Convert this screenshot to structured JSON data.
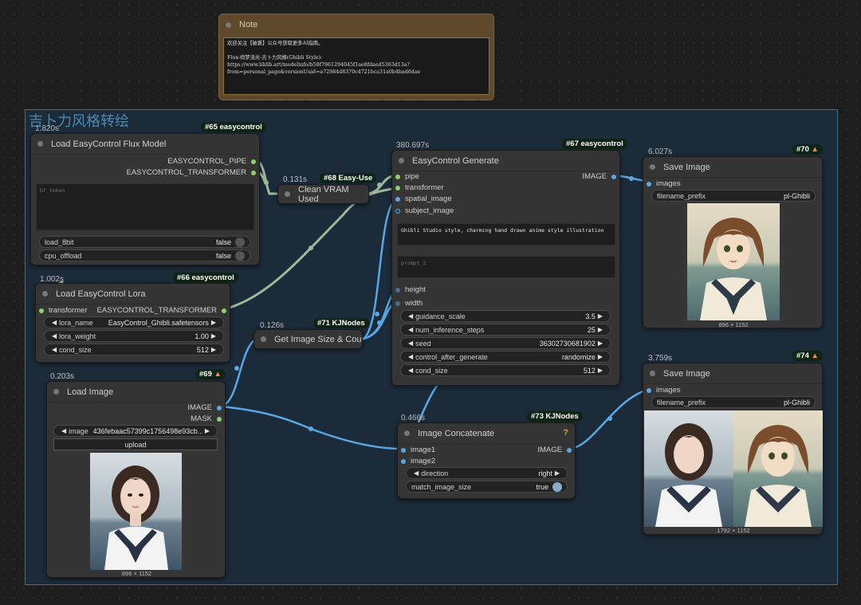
{
  "group": {
    "title": "吉卜力风格转绘"
  },
  "note": {
    "title": "Note",
    "text": "欢迎关注【破褒】公众号获取更多AI指南。\n\nFlux-绮梦流光-吉卜力风格(Ghibli Style):\nhttps://www.liblib.art/modelinfo/b58f7961294045f1ae8fdaed5363d13a?\nfrom=personal_page&versionUuid=a72984d8370c4721bca31a0b4bad6dae"
  },
  "nodes": {
    "n65": {
      "badge": "#65 easycontrol",
      "time": "1.820s",
      "title": "Load EasyControl Flux Model",
      "out1": "EASYCONTROL_PIPE",
      "out2": "EASYCONTROL_TRANSFORMER",
      "textarea_placeholder": "hf_token",
      "w1_label": "load_8bit",
      "w1_value": "false",
      "w2_label": "cpu_offload",
      "w2_value": "false"
    },
    "n66": {
      "badge": "#66 easycontrol",
      "time": "1.002s",
      "title": "Load EasyControl Lora",
      "in1": "transformer",
      "out1": "EASYCONTROL_TRANSFORMER",
      "w1_label": "lora_name",
      "w1_value": "EasyControl_Ghibli.safetensors",
      "w2_label": "lora_weight",
      "w2_value": "1.00",
      "w3_label": "cond_size",
      "w3_value": "512"
    },
    "n68": {
      "badge": "#68 Easy-Use",
      "time": "0.131s",
      "title": "Clean VRAM Used"
    },
    "n71": {
      "badge": "#71 KJNodes",
      "time": "0.126s",
      "title": "Get Image Size & Cou"
    },
    "n69": {
      "badge": "#69",
      "time": "0.203s",
      "title": "Load Image",
      "out1": "IMAGE",
      "out2": "MASK",
      "w1_label": "image",
      "w1_value": "436febaac57399c1756498e93cb...",
      "upload": "upload",
      "caption": "896 × 1152"
    },
    "n67": {
      "badge": "#67 easycontrol",
      "time": "380.697s",
      "title": "EasyControl Generate",
      "in1": "pipe",
      "in2": "transformer",
      "in3": "spatial_image",
      "in4": "subject_image",
      "out1": "IMAGE",
      "prompt": "Ghibli Studio style, charming hand drawn anime style illustration",
      "prompt2_placeholder": "prompt_2",
      "in5": "height",
      "in6": "width",
      "w1_label": "guidance_scale",
      "w1_value": "3.5",
      "w2_label": "num_inference_steps",
      "w2_value": "25",
      "w3_label": "seed",
      "w3_value": "36302730681902",
      "w4_label": "control_after_generate",
      "w4_value": "randomize",
      "w5_label": "cond_size",
      "w5_value": "512"
    },
    "n73": {
      "badge": "#73 KJNodes",
      "time": "0.466s",
      "title": "Image Concatenate",
      "q": "?",
      "in1": "image1",
      "in2": "image2",
      "out1": "IMAGE",
      "w1_label": "direction",
      "w1_value": "right",
      "w2_label": "match_image_size",
      "w2_value": "true"
    },
    "n70": {
      "badge": "#70",
      "time": "6.027s",
      "title": "Save Image",
      "in1": "images",
      "w1_label": "filename_prefix",
      "w1_value": "pl-Ghibli",
      "caption": "896 × 1152"
    },
    "n74": {
      "badge": "#74",
      "time": "3.759s",
      "title": "Save Image",
      "in1": "images",
      "w1_label": "filename_prefix",
      "w1_value": "pl-Ghibli",
      "caption": "1792 × 1152"
    }
  },
  "colors": {
    "link_image": "#5aa7e6",
    "link_model": "#9fb89a",
    "group_border": "#3c6d8f",
    "badge_bg": "#0f2415"
  },
  "icons": {
    "fox": "fox-icon",
    "help": "help-icon"
  }
}
